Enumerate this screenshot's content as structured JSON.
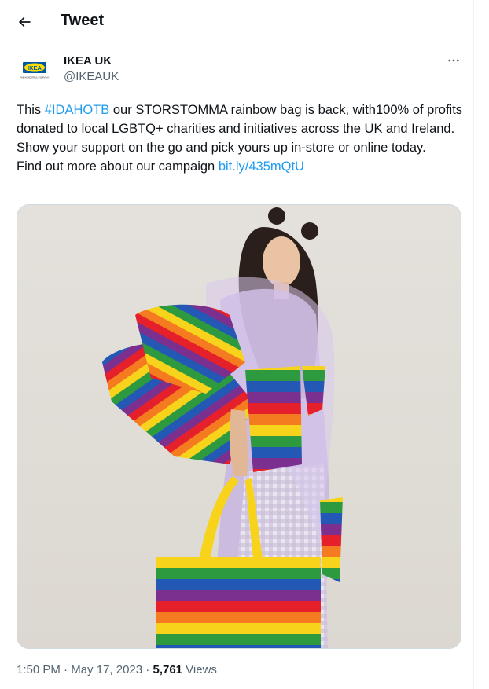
{
  "header": {
    "title": "Tweet"
  },
  "author": {
    "name": "IKEA UK",
    "handle": "@IKEAUK",
    "logo_text": "IKEA",
    "logo_tagline": "THE WONDERFUL EVERYDAY"
  },
  "tweet": {
    "part1": "This ",
    "hashtag": "#IDAHOTB",
    "part2": " our STORSTOMMA rainbow bag is back, with100% of profits donated to local LGBTQ+ charities and initiatives across the UK and Ireland. Show your support on the go and pick yours up in-store or online today.",
    "part3": "Find out more about our campaign ",
    "link": "bit.ly/435mQtU"
  },
  "meta": {
    "time": "1:50 PM",
    "sep1": " · ",
    "date": "May 17, 2023",
    "sep2": " · ",
    "views_count": "5,761",
    "views_label": " Views"
  },
  "colors": {
    "link": "#1d9bf0",
    "text": "#0f1419",
    "muted": "#536471",
    "ikea_blue": "#0058a3",
    "ikea_yellow": "#ffdb00"
  },
  "icons": {
    "back": "arrow-left-icon",
    "more": "more-horizontal-icon"
  }
}
